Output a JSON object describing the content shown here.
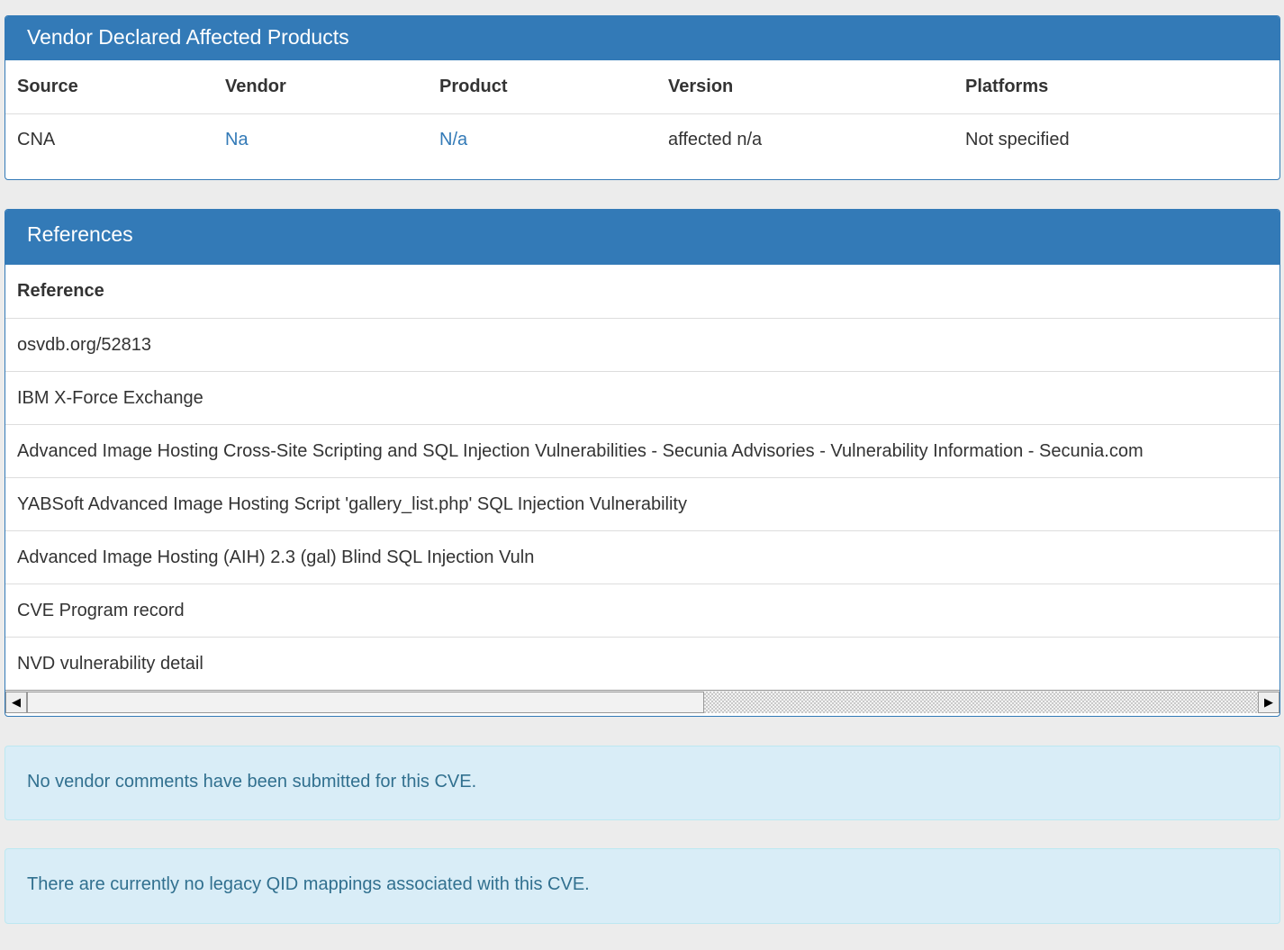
{
  "affected_products": {
    "heading": "Vendor Declared Affected Products",
    "columns": [
      "Source",
      "Vendor",
      "Product",
      "Version",
      "Platforms"
    ],
    "rows": [
      {
        "source": "CNA",
        "vendor": "Na",
        "product": "N/a",
        "version": "affected n/a",
        "platforms": "Not specified"
      }
    ]
  },
  "references": {
    "heading": "References",
    "column": "Reference",
    "items": [
      "osvdb.org/52813",
      "IBM X-Force Exchange",
      "Advanced Image Hosting Cross-Site Scripting and SQL Injection Vulnerabilities - Secunia Advisories - Vulnerability Information - Secunia.com",
      "YABSoft Advanced Image Hosting Script 'gallery_list.php' SQL Injection Vulnerability",
      "Advanced Image Hosting (AIH) 2.3 (gal) Blind SQL Injection Vuln",
      "CVE Program record",
      "NVD vulnerability detail"
    ],
    "scrollbar": {
      "left_arrow": "◀",
      "right_arrow": "▶",
      "scroll_fraction": 0.55
    }
  },
  "vendor_comments_notice": "No vendor comments have been submitted for this CVE.",
  "qid_mappings_notice": "There are currently no legacy QID mappings associated with this CVE.",
  "colors": {
    "accent": "#337ab7",
    "info_bg": "#d9edf7",
    "info_text": "#31708f"
  }
}
